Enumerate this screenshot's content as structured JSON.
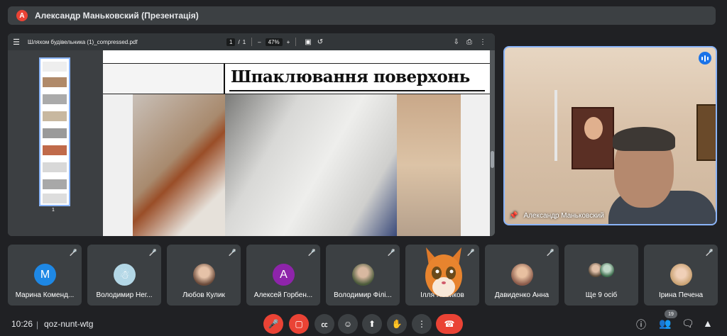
{
  "presentation": {
    "avatar_letter": "А",
    "title": "Александр Маньковский (Презентація)"
  },
  "pdf": {
    "filename": "Шляхом будівельника (1)_compressed.pdf",
    "page_current": "1",
    "page_separator": "/",
    "page_total": "1",
    "zoom_minus": "–",
    "zoom_value": "47%",
    "zoom_plus": "+",
    "thumb_number": "1",
    "slide_title": "Шпаклювання поверхонь"
  },
  "presenter": {
    "name": "Александр Маньковский"
  },
  "participants": [
    {
      "name": "Марина Коменд...",
      "initial": "М",
      "color": "#1e88e5"
    },
    {
      "name": "Володимир Нег...",
      "initial": "",
      "color": "#b3d7e6"
    },
    {
      "name": "Любов Кулик",
      "initial": "",
      "color": "#a08070"
    },
    {
      "name": "Алексей Горбен...",
      "initial": "А",
      "color": "#8e24aa"
    },
    {
      "name": "Володимир Філі...",
      "initial": "",
      "color": "#7a7a6a"
    },
    {
      "name": "Ілля Новиков",
      "initial": "",
      "color": "#3c4043"
    },
    {
      "name": "Давиденко Анна",
      "initial": "",
      "color": "#8a6a5a"
    },
    {
      "name": "Ще 9 осіб",
      "initial": "",
      "color": "#3c4043"
    },
    {
      "name": "Ірина Печена",
      "initial": "",
      "color": "#d8c0a8"
    }
  ],
  "bottom": {
    "time": "10:26",
    "separator": "|",
    "meeting_code": "qoz-nunt-wtg",
    "people_count": "19"
  }
}
